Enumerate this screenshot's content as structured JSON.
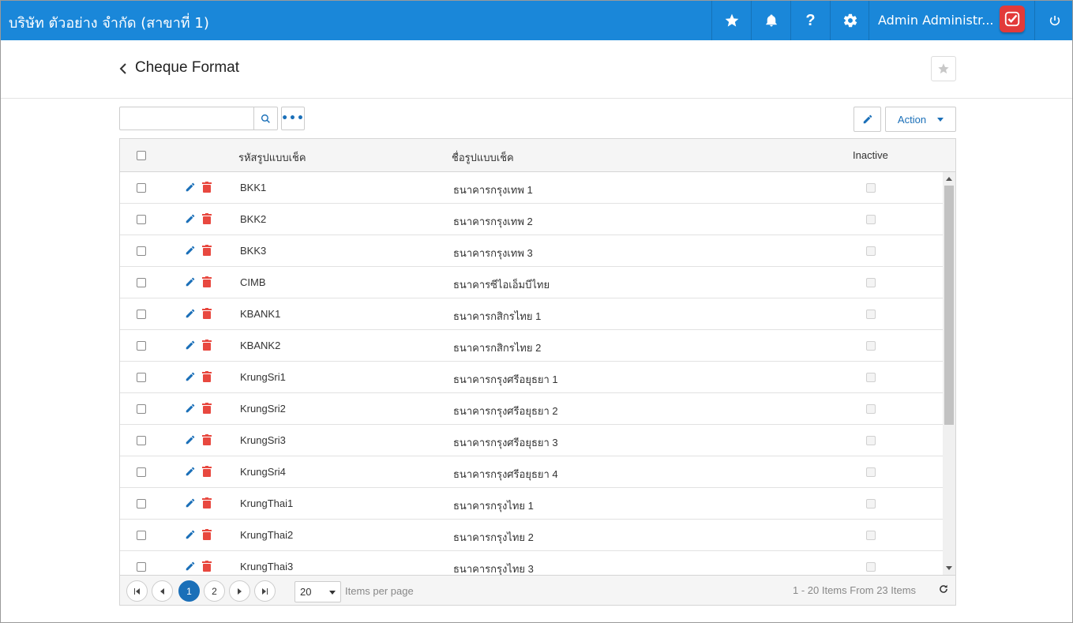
{
  "topbar": {
    "company": "บริษัท ตัวอย่าง จำกัด (สาขาที่ 1)",
    "help_label": "?",
    "user_name": "Admin Administr...",
    "accent": "#1a87d9"
  },
  "page": {
    "title": "Cheque Format"
  },
  "toolbar": {
    "search_value": "",
    "more_label": "•••",
    "action_label": "Action"
  },
  "grid": {
    "columns": {
      "code": "รหัสรูปแบบเช็ค",
      "name": "ชื่อรูปแบบเช็ค",
      "inactive": "Inactive"
    },
    "rows": [
      {
        "code": "BKK1",
        "name": "ธนาคารกรุงเทพ 1"
      },
      {
        "code": "BKK2",
        "name": "ธนาคารกรุงเทพ 2"
      },
      {
        "code": "BKK3",
        "name": "ธนาคารกรุงเทพ 3"
      },
      {
        "code": "CIMB",
        "name": "ธนาคารซีไอเอ็มบีไทย"
      },
      {
        "code": "KBANK1",
        "name": "ธนาคารกสิกรไทย 1"
      },
      {
        "code": "KBANK2",
        "name": "ธนาคารกสิกรไทย 2"
      },
      {
        "code": "KrungSri1",
        "name": "ธนาคารกรุงศรีอยุธยา 1"
      },
      {
        "code": "KrungSri2",
        "name": "ธนาคารกรุงศรีอยุธยา 2"
      },
      {
        "code": "KrungSri3",
        "name": "ธนาคารกรุงศรีอยุธยา 3"
      },
      {
        "code": "KrungSri4",
        "name": "ธนาคารกรุงศรีอยุธยา 4"
      },
      {
        "code": "KrungThai1",
        "name": "ธนาคารกรุงไทย 1"
      },
      {
        "code": "KrungThai2",
        "name": "ธนาคารกรุงไทย 2"
      },
      {
        "code": "KrungThai3",
        "name": "ธนาคารกรุงไทย 3"
      }
    ]
  },
  "pager": {
    "pages": [
      "1",
      "2"
    ],
    "current": "1",
    "page_size": "20",
    "items_per_page_label": "Items per page",
    "info": "1 - 20 Items From 23 Items"
  }
}
